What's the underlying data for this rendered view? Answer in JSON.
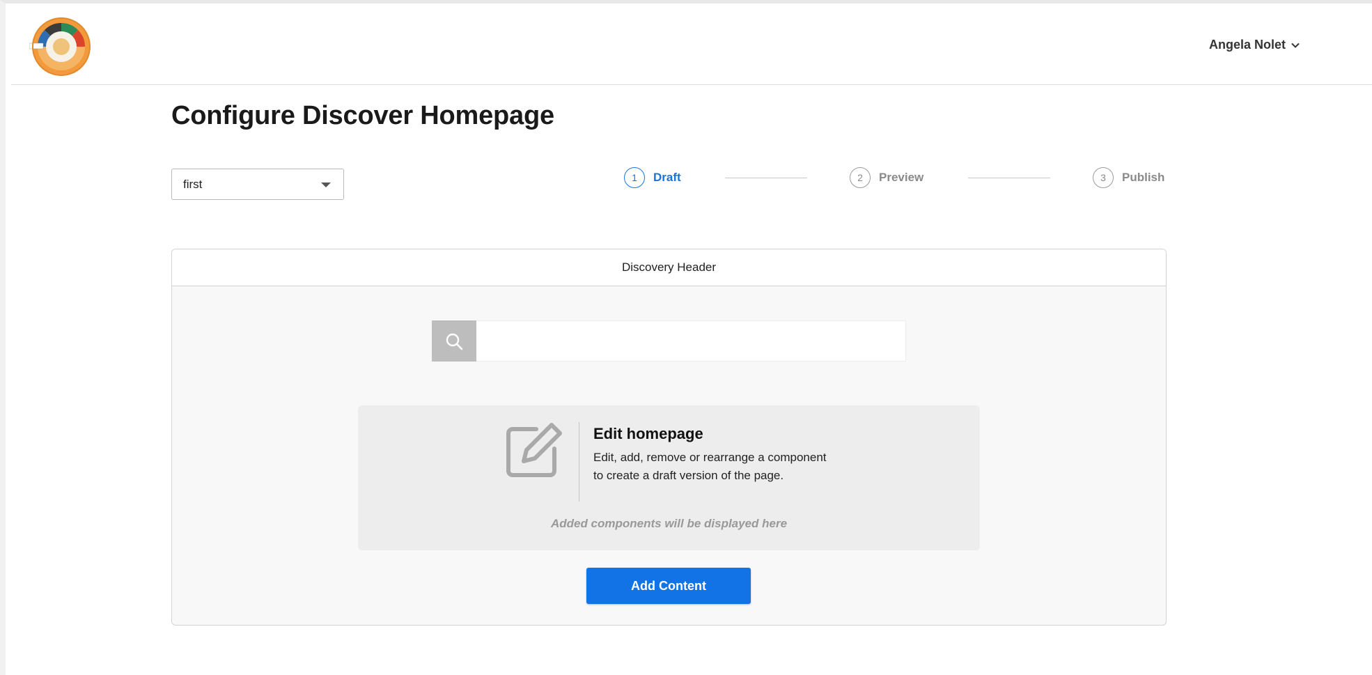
{
  "header": {
    "logo_icon": "circular-org-logo",
    "user_name": "Angela Nolet",
    "user_menu_icon": "chevron-down-icon"
  },
  "page": {
    "title": "Configure Discover Homepage"
  },
  "select": {
    "value": "first"
  },
  "stepper": {
    "steps": [
      {
        "number": "1",
        "label": "Draft",
        "active": true
      },
      {
        "number": "2",
        "label": "Preview",
        "active": false
      },
      {
        "number": "3",
        "label": "Publish",
        "active": false
      }
    ]
  },
  "card": {
    "header": "Discovery Header",
    "search": {
      "icon": "search-icon",
      "placeholder": "",
      "value": ""
    },
    "edit": {
      "icon": "edit-icon",
      "title": "Edit homepage",
      "description": "Edit, add, remove or rearrange a component to create a draft version of the page.",
      "hint": "Added components will be displayed here"
    },
    "add_button": "Add Content"
  },
  "colors": {
    "accent": "#1273e6",
    "active_step": "#1a73d9"
  }
}
